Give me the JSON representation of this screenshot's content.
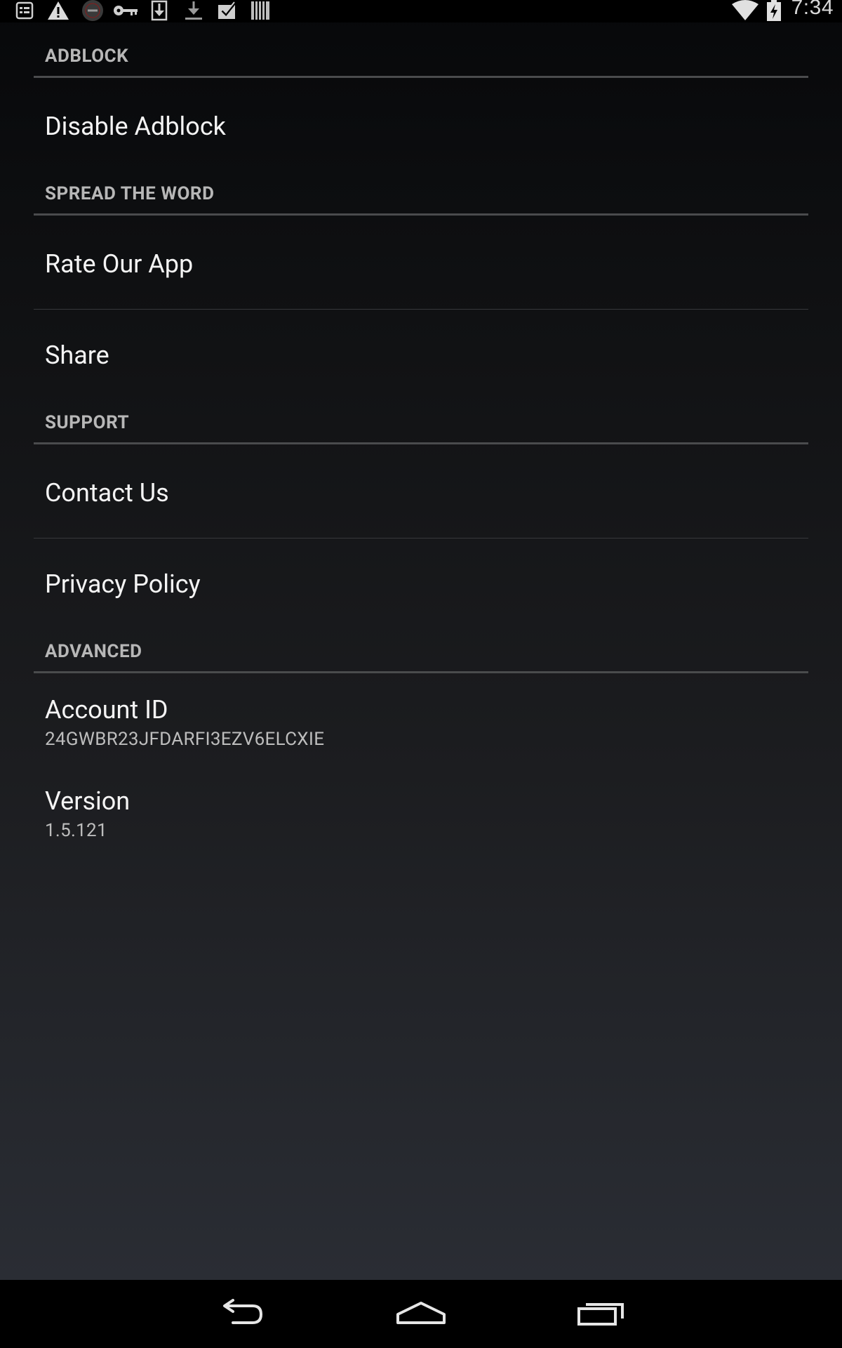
{
  "status_bar": {
    "time": "7:34",
    "notification_icons": [
      "notes-icon",
      "warning-icon",
      "adblock-app-icon",
      "key-icon",
      "download-icon",
      "download-complete-icon",
      "checkbox-icon",
      "barcode-icon"
    ],
    "system_icons": [
      "wifi-icon",
      "battery-charging-icon"
    ]
  },
  "sections": {
    "adblock": {
      "header": "ADBLOCK",
      "items": [
        {
          "title": "Disable Adblock"
        }
      ]
    },
    "spread": {
      "header": "SPREAD THE WORD",
      "items": [
        {
          "title": "Rate Our App"
        },
        {
          "title": "Share"
        }
      ]
    },
    "support": {
      "header": "SUPPORT",
      "items": [
        {
          "title": "Contact Us"
        },
        {
          "title": "Privacy Policy"
        }
      ]
    },
    "advanced": {
      "header": "ADVANCED",
      "items": [
        {
          "title": "Account ID",
          "summary": "24GWBR23JFDARFI3EZV6ELCXIE"
        },
        {
          "title": "Version",
          "summary": "1.5.121"
        }
      ]
    }
  },
  "nav_bar": {
    "buttons": [
      "back-icon",
      "home-icon",
      "recent-apps-icon"
    ]
  },
  "colors": {
    "background_top": "#07080a",
    "background_bottom": "#2a2d34",
    "header_text": "#b7b7b7",
    "divider": "#4a4b4d",
    "title_text": "#f4f4f4",
    "summary_text": "#bdbdbd"
  }
}
